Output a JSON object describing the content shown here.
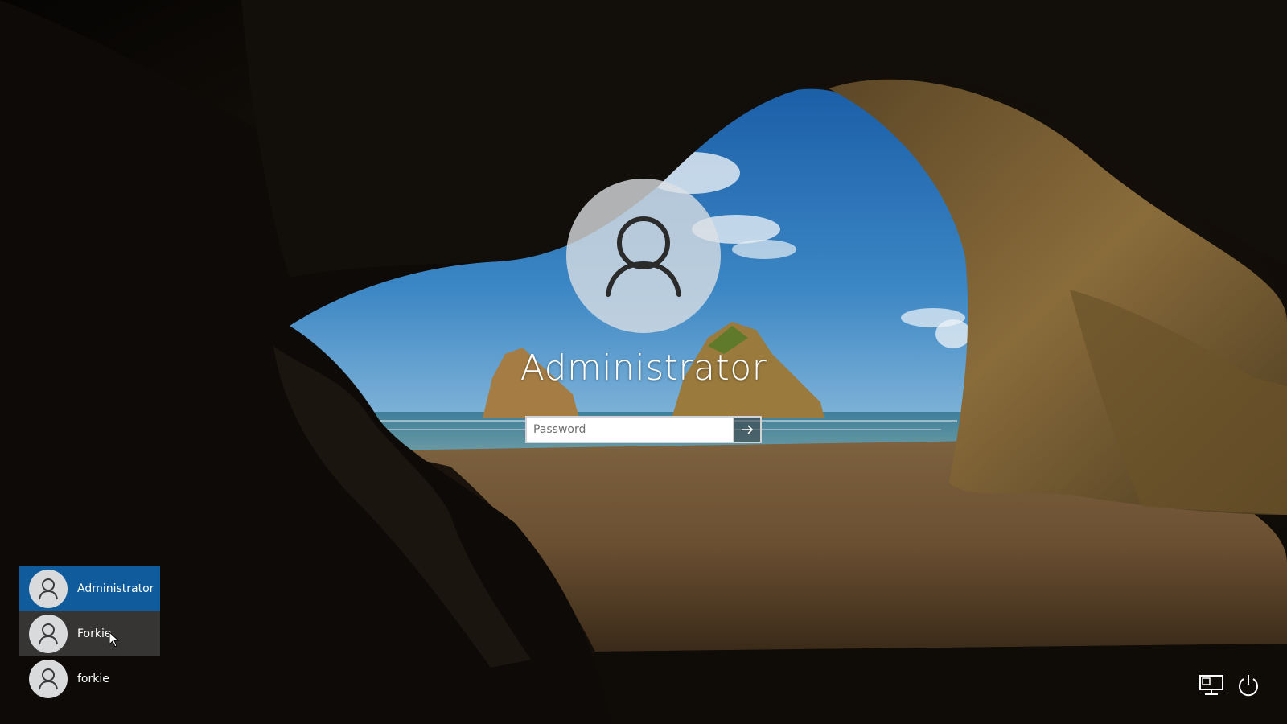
{
  "login": {
    "user_name": "Administrator",
    "password_placeholder": "Password"
  },
  "user_list": [
    {
      "label": "Administrator",
      "state": "selected"
    },
    {
      "label": "Forkie",
      "state": "hovered"
    },
    {
      "label": "forkie",
      "state": "normal"
    }
  ],
  "icons": {
    "avatar": "user-silhouette-icon",
    "submit": "arrow-right-icon",
    "network": "network-icon",
    "power": "power-icon"
  },
  "colors": {
    "selected_user": "#0f5b9c",
    "hovered_user": "#5a5a5a",
    "input_border": "#cfd3d6"
  }
}
